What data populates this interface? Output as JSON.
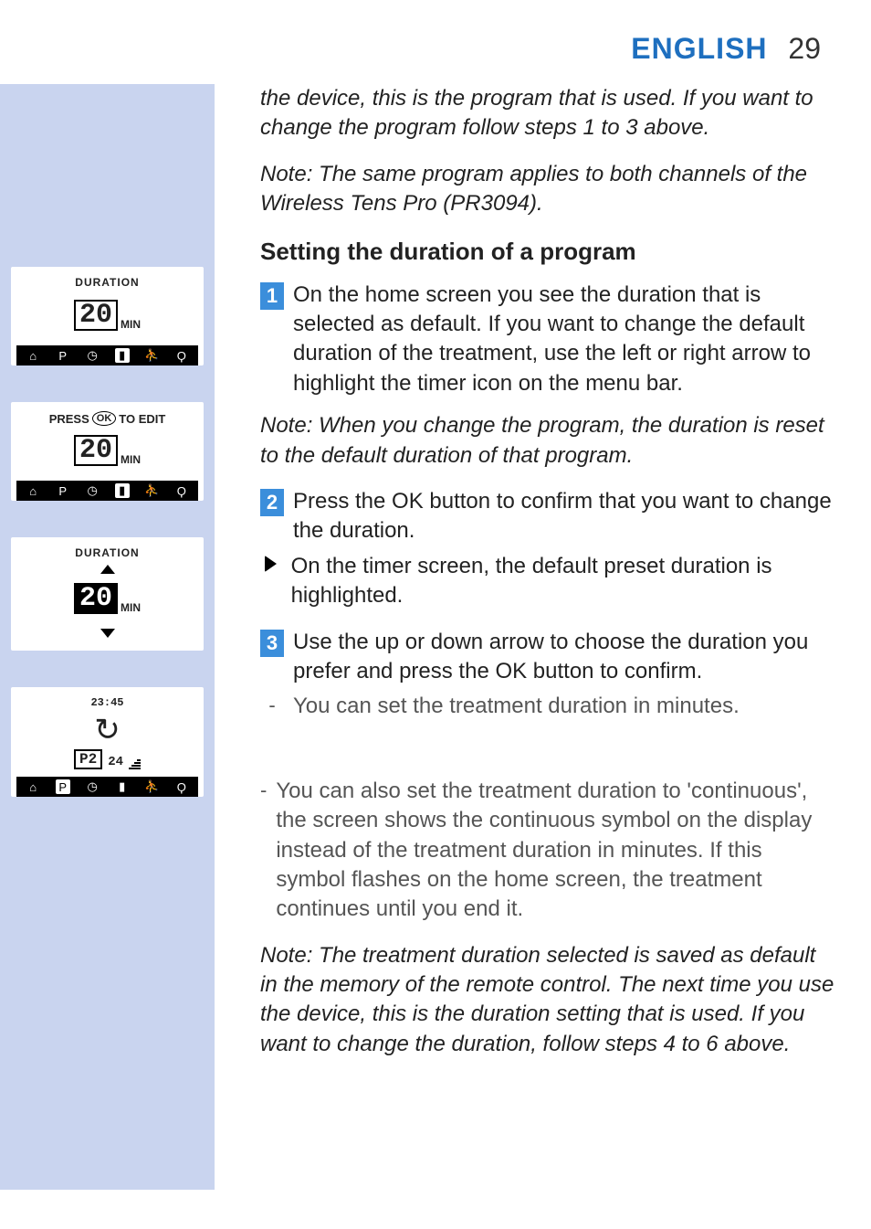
{
  "header": {
    "language": "ENGLISH",
    "page_number": "29"
  },
  "sidebar": {
    "fig1": {
      "title": "DURATION",
      "value": "20",
      "unit": "MIN",
      "menu_highlight": "clock",
      "menu_icons": [
        "home",
        "P",
        "clock",
        "battery",
        "person",
        "Y"
      ]
    },
    "fig2": {
      "press_label_left": "PRESS",
      "press_label_ok": "OK",
      "press_label_right": "TO EDIT",
      "value": "20",
      "unit": "MIN",
      "menu_highlight": "battery",
      "menu_icons": [
        "home",
        "P",
        "clock",
        "battery",
        "person",
        "Y"
      ]
    },
    "fig3": {
      "title": "DURATION",
      "value": "20",
      "unit": "MIN"
    },
    "fig4": {
      "top_value": "23:45",
      "program": "P2",
      "battery_level": "24",
      "menu_highlight": "P"
    }
  },
  "content": {
    "intro1": "the device, this is the program that is used. If you want to change the program follow steps 1 to 3 above.",
    "note1": "Note: The same program applies to both channels of the Wireless Tens Pro (PR3094).",
    "heading": "Setting the duration of a program",
    "step1_num": "1",
    "step1": "On the home screen you see the duration that is selected as default. If you want to change the default duration of the treatment, use the left or right arrow to highlight the timer icon on the menu bar.",
    "note2": "Note: When you change the program, the duration is reset to the default duration of that program.",
    "step2_num": "2",
    "step2": " Press the OK button to confirm that you want to change the duration.",
    "sub2": "On the timer screen, the default preset duration is highlighted.",
    "step3_num": "3",
    "step3": "Use the up or down arrow to choose the duration you prefer and press the OK button to confirm.",
    "sub3": "You can set the treatment duration in minutes.",
    "sub4": "You can also set the treatment duration to 'continuous', the screen shows the continuous symbol on the display instead of the treatment duration in minutes. If this symbol flashes on the home screen, the treatment continues until you end it.",
    "note3": "Note: The treatment duration selected is saved as default in the memory of the remote control. The next time you use the device, this is the duration setting that is used. If you want to change the duration, follow steps 4 to 6 above."
  }
}
